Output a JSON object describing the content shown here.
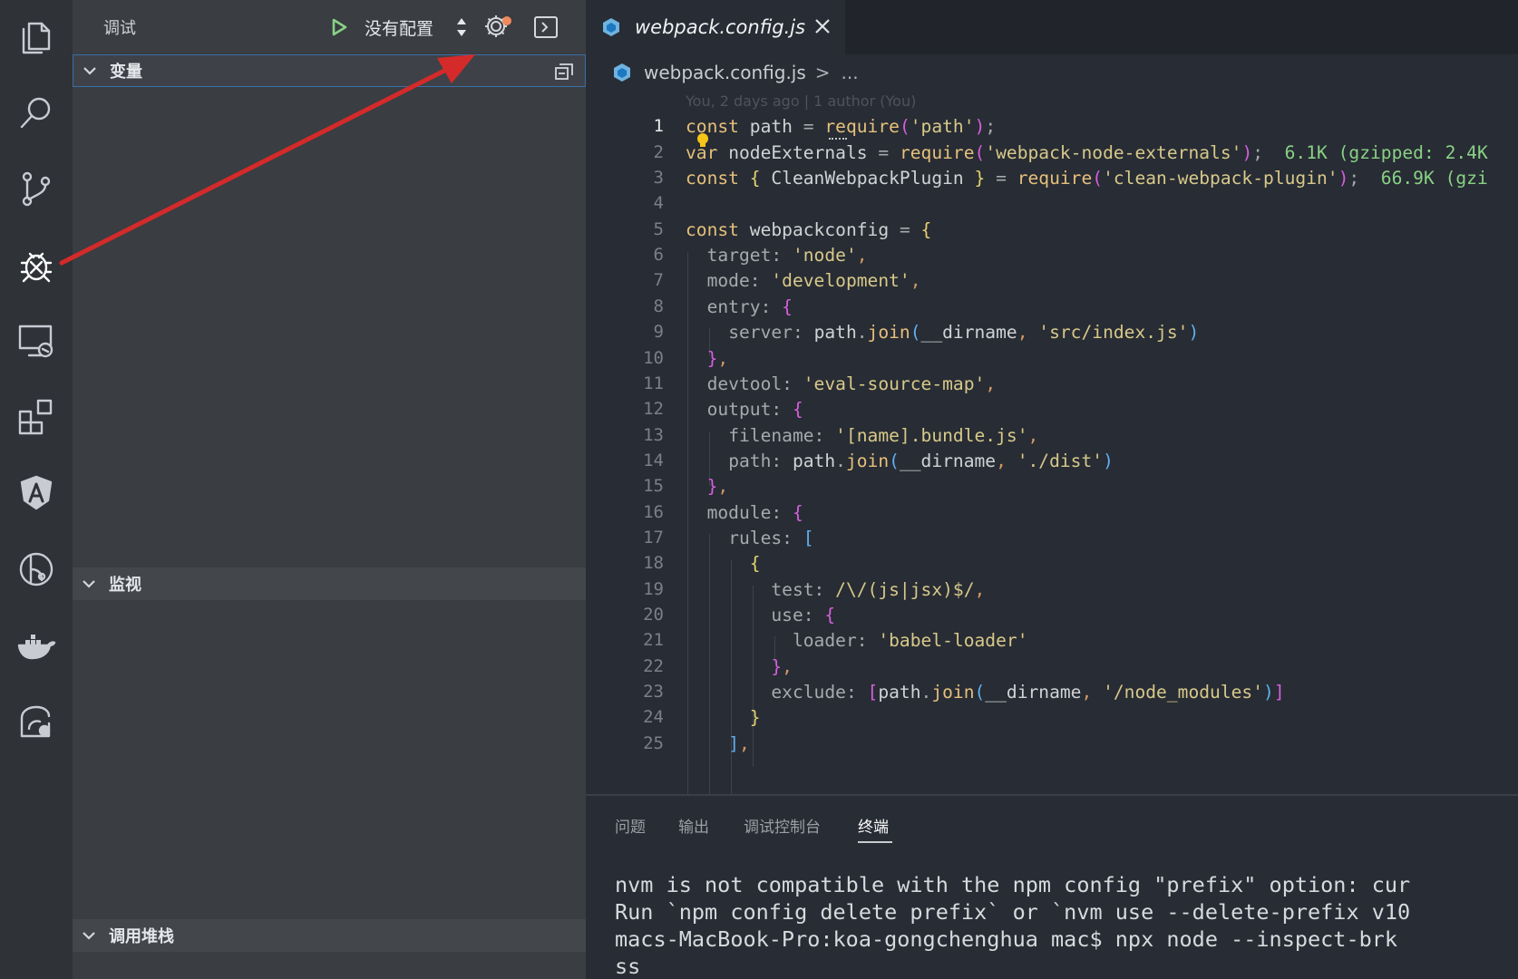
{
  "sidebar": {
    "title": "调试",
    "config_label": "没有配置",
    "sections": {
      "variables": "变量",
      "watch": "监视",
      "callstack": "调用堆栈"
    }
  },
  "activity_bar": {
    "icons": [
      "files-icon",
      "search-icon",
      "source-control-icon",
      "debug-icon",
      "remote-explorer-icon",
      "extensions-icon",
      "angular-icon",
      "gitlens-icon",
      "docker-icon",
      "remote-icon"
    ]
  },
  "editor": {
    "tab_label": "webpack.config.js",
    "breadcrumb": {
      "file": "webpack.config.js",
      "separator": ">",
      "more": "..."
    },
    "codelens": "You, 2 days ago | 1 author (You)",
    "line_numbers": [
      "1",
      "2",
      "3",
      "4",
      "5",
      "6",
      "7",
      "8",
      "9",
      "10",
      "11",
      "12",
      "13",
      "14",
      "15",
      "16",
      "17",
      "18",
      "19",
      "20",
      "21",
      "22",
      "23",
      "24",
      "25"
    ],
    "size_hints": {
      "line2": "6.1K (gzipped: 2.4K",
      "line3": "66.9K (gzi"
    }
  },
  "panel": {
    "tabs": [
      "问题",
      "输出",
      "调试控制台",
      "终端"
    ],
    "active_tab": "终端",
    "terminal_lines": [
      "nvm is not compatible with the npm config \"prefix\" option: cur",
      "Run `npm config delete prefix` or `nvm use --delete-prefix v10",
      "macs-MacBook-Pro:koa-gongchenghua mac$ npx node --inspect-brk",
      "ss"
    ]
  },
  "colors": {
    "annotation_arrow": "#d42a2a",
    "run_green": "#89d185"
  }
}
